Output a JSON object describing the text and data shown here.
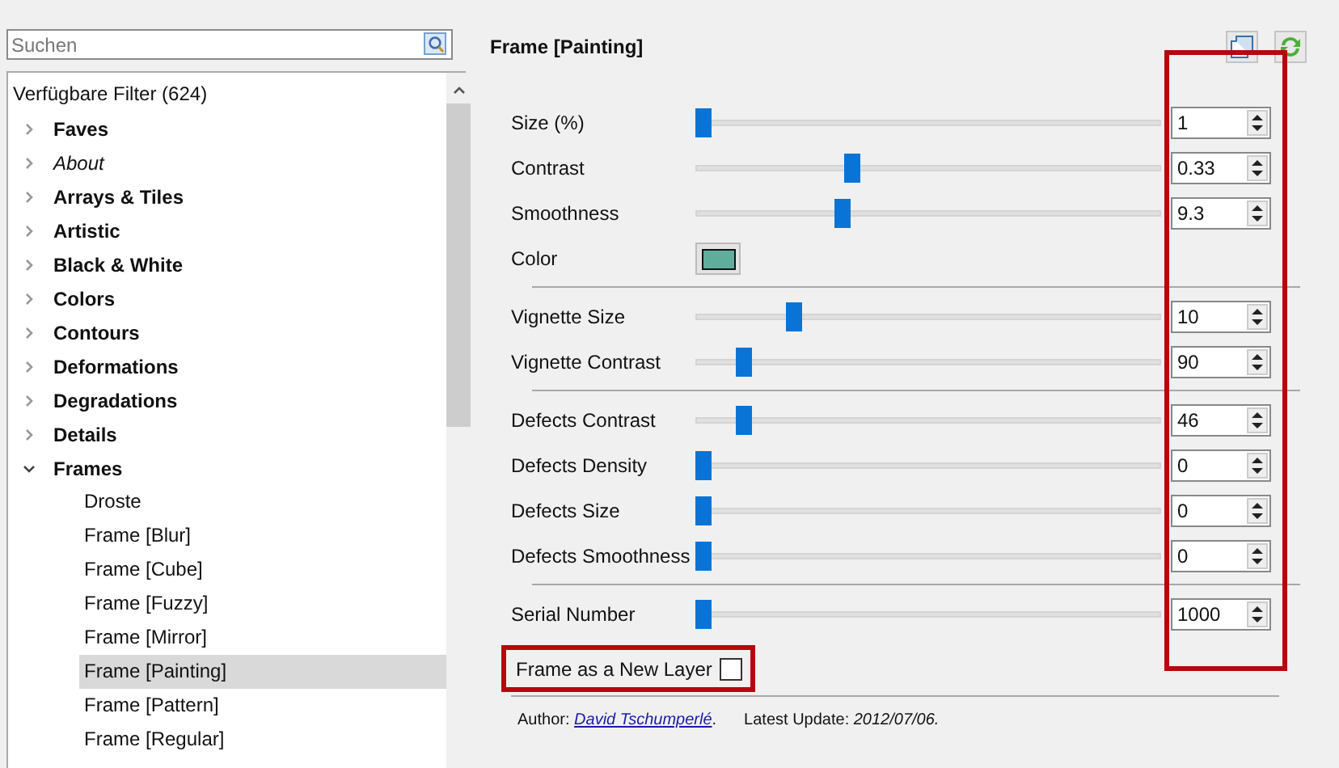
{
  "search": {
    "placeholder": "Suchen"
  },
  "tree": {
    "label": "Verfügbare Filter (624)",
    "items": [
      {
        "label": "Faves",
        "kind": "category",
        "expanded": false,
        "selected": false
      },
      {
        "label": "About",
        "kind": "info",
        "expanded": false,
        "selected": false
      },
      {
        "label": "Arrays & Tiles",
        "kind": "category",
        "expanded": false,
        "selected": false
      },
      {
        "label": "Artistic",
        "kind": "category",
        "expanded": false,
        "selected": false
      },
      {
        "label": "Black & White",
        "kind": "category",
        "expanded": false,
        "selected": false
      },
      {
        "label": "Colors",
        "kind": "category",
        "expanded": false,
        "selected": false
      },
      {
        "label": "Contours",
        "kind": "category",
        "expanded": false,
        "selected": false
      },
      {
        "label": "Deformations",
        "kind": "category",
        "expanded": false,
        "selected": false
      },
      {
        "label": "Degradations",
        "kind": "category",
        "expanded": false,
        "selected": false
      },
      {
        "label": "Details",
        "kind": "category",
        "expanded": false,
        "selected": false
      },
      {
        "label": "Frames",
        "kind": "category",
        "expanded": true,
        "selected": false,
        "children": [
          {
            "label": "Droste",
            "selected": false
          },
          {
            "label": "Frame [Blur]",
            "selected": false
          },
          {
            "label": "Frame [Cube]",
            "selected": false
          },
          {
            "label": "Frame [Fuzzy]",
            "selected": false
          },
          {
            "label": "Frame [Mirror]",
            "selected": false
          },
          {
            "label": "Frame [Painting]",
            "selected": true
          },
          {
            "label": "Frame [Pattern]",
            "selected": false
          },
          {
            "label": "Frame [Regular]",
            "selected": false
          }
        ]
      }
    ]
  },
  "filter": {
    "title": "Frame [Painting]",
    "params_highlighted": true,
    "params": [
      {
        "kind": "slider",
        "label": "Size (%)",
        "level": 0.0,
        "value": "1"
      },
      {
        "kind": "slider",
        "label": "Contrast",
        "level": 0.33,
        "value": "0.33"
      },
      {
        "kind": "slider",
        "label": "Smoothness",
        "level": 0.31,
        "value": "9.3"
      },
      {
        "kind": "color",
        "label": "Color",
        "color": "#5fae9c"
      },
      {
        "kind": "separator"
      },
      {
        "kind": "slider",
        "label": "Vignette Size",
        "level": 0.2,
        "value": "10"
      },
      {
        "kind": "slider",
        "label": "Vignette Contrast",
        "level": 0.09,
        "value": "90"
      },
      {
        "kind": "separator"
      },
      {
        "kind": "slider",
        "label": "Defects Contrast",
        "level": 0.09,
        "value": "46"
      },
      {
        "kind": "slider",
        "label": "Defects Density",
        "level": 0.0,
        "value": "0"
      },
      {
        "kind": "slider",
        "label": "Defects Size",
        "level": 0.0,
        "value": "0"
      },
      {
        "kind": "slider",
        "label": "Defects Smoothness",
        "level": 0.0,
        "value": "0"
      },
      {
        "kind": "separator"
      },
      {
        "kind": "slider",
        "label": "Serial Number",
        "level": 0.0,
        "value": "1000"
      }
    ],
    "layer_option": {
      "label": "Frame as a New Layer",
      "checked": false,
      "highlighted": true
    },
    "author_label": "Author:",
    "author": "David Tschumperlé",
    "author_end": ".",
    "update_label": "Latest Update:",
    "update": "2012/07/06."
  }
}
